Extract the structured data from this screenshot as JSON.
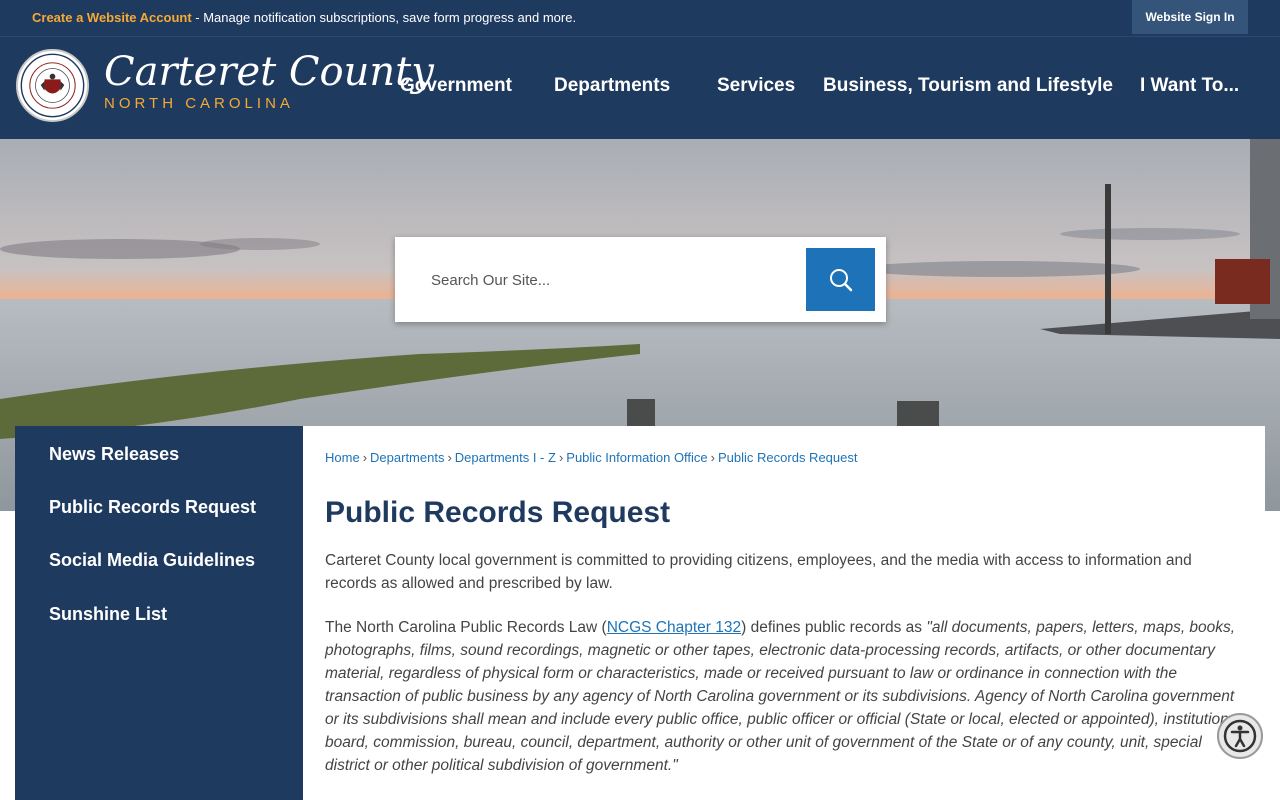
{
  "topbar": {
    "create_link": "Create a Website Account",
    "message": " - Manage notification subscriptions, save form progress and more.",
    "signin_label": "Website Sign In"
  },
  "header": {
    "logo_name": "Carteret County",
    "logo_sub": "NORTH CAROLINA",
    "nav": [
      {
        "label": "Government"
      },
      {
        "label": "Departments"
      },
      {
        "label": "Services"
      },
      {
        "label": "Business, Tourism and Lifestyle"
      },
      {
        "label": "I Want To..."
      }
    ]
  },
  "search": {
    "placeholder": "Search Our Site..."
  },
  "sidebar": {
    "items": [
      {
        "label": "News Releases"
      },
      {
        "label": "Public Records Request"
      },
      {
        "label": "Social Media Guidelines"
      },
      {
        "label": "Sunshine List"
      }
    ]
  },
  "main": {
    "breadcrumb": [
      "Home",
      "Departments",
      "Departments I - Z",
      "Public Information Office",
      "Public Records Request"
    ],
    "title": "Public Records Request",
    "intro": "Carteret County local government is committed to providing citizens, employees, and the media with access to information and records as allowed and prescribed by law.",
    "law_prefix": "The North Carolina Public Records Law (",
    "law_link": "NCGS Chapter 132",
    "law_mid": ") defines public records as ",
    "law_quote": "\"all documents, papers, letters, maps, books, photographs, films, sound recordings, magnetic or other tapes, electronic data-processing records, artifacts, or other documentary material, regardless of physical form or characteristics, made or received pursuant to law or ordinance in connection with the transaction of public business by any agency of North Carolina government or its subdivisions. Agency of North Carolina government or its subdivisions shall mean and include every public office, public officer or official (State or local, elected or appointed), institution, board, commission, bureau, council, department, authority or other unit of government of the State or of any county, unit, special district or other political subdivision of government.\""
  },
  "colors": {
    "navy": "#1f3a5f",
    "accent_orange": "#f6a934",
    "link_blue": "#1e73b8"
  },
  "icons": {
    "search": "search-icon",
    "accessibility": "accessibility-icon",
    "seal": "county-seal-icon"
  }
}
